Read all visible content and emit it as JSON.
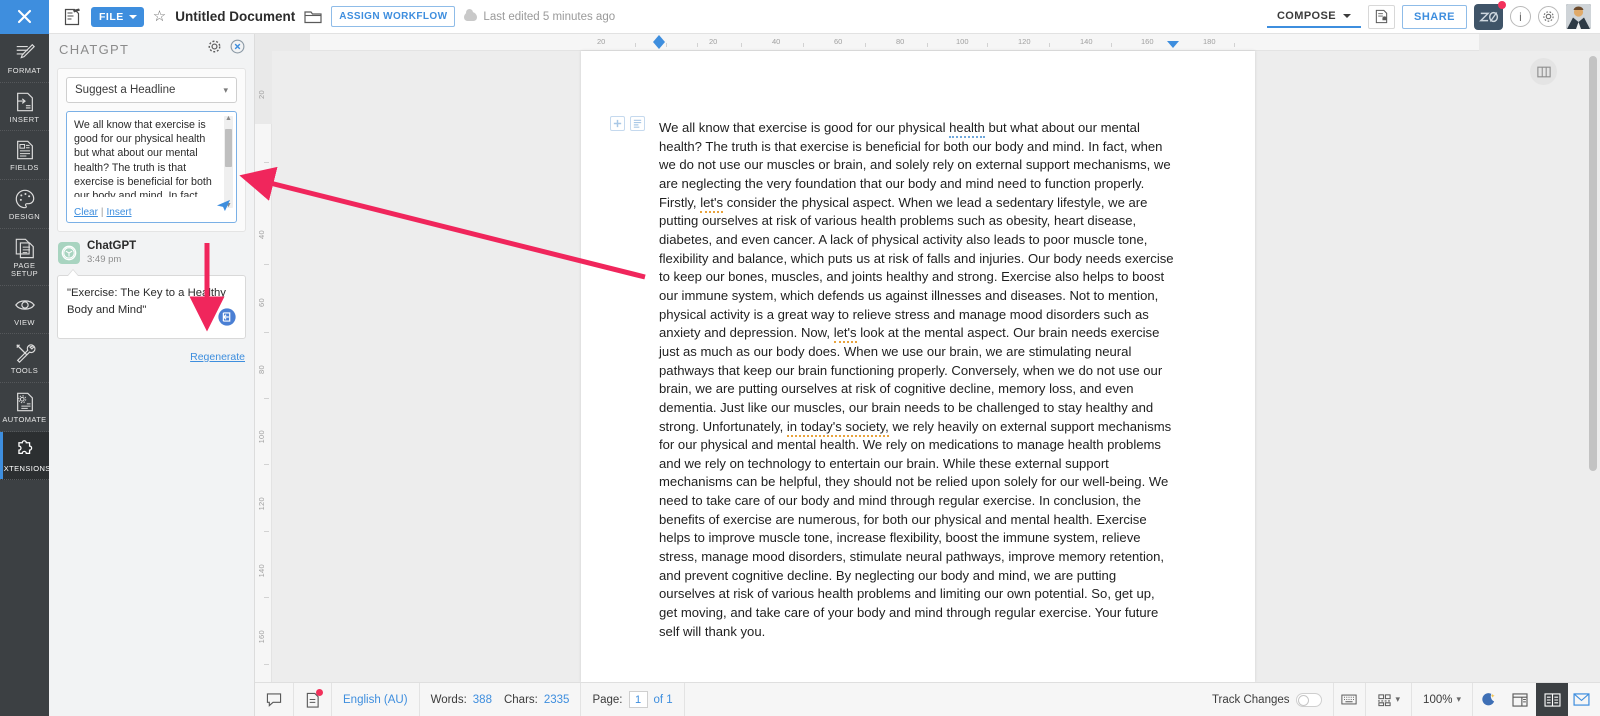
{
  "topbar": {
    "close_icon": "close-x-icon",
    "doc_icon": "document-edit-icon",
    "file_label": "FILE",
    "star_icon": "star-outline-icon",
    "title": "Untitled Document",
    "folder_icon": "folder-icon",
    "assign_workflow_label": "ASSIGN WORKFLOW",
    "last_edited": "Last edited 5 minutes ago",
    "compose_label": "COMPOSE",
    "notify_icon": "document-bell-icon",
    "share_label": "SHARE",
    "zia_label": "Zia",
    "info_icon": "info-circle-icon",
    "settings_icon": "gear-icon",
    "avatar_icon": "user-avatar"
  },
  "rail": {
    "items": [
      {
        "label": "FORMAT",
        "icon": "format-brush-icon",
        "active": false
      },
      {
        "label": "INSERT",
        "icon": "insert-page-icon",
        "active": false
      },
      {
        "label": "FIELDS",
        "icon": "fields-document-icon",
        "active": false
      },
      {
        "label": "DESIGN",
        "icon": "design-palette-icon",
        "active": false
      },
      {
        "label": "PAGE SETUP",
        "icon": "page-setup-icon",
        "active": false
      },
      {
        "label": "VIEW",
        "icon": "eye-icon",
        "active": false
      },
      {
        "label": "TOOLS",
        "icon": "tools-wrench-icon",
        "active": false
      },
      {
        "label": "AUTOMATE",
        "icon": "automate-gear-doc-icon",
        "active": false
      },
      {
        "label": "EXTENSIONS",
        "icon": "puzzle-piece-icon",
        "active": true
      }
    ]
  },
  "panel": {
    "title": "CHATGPT",
    "settings_icon": "gear-icon",
    "close_icon": "close-circle-icon",
    "prompt_type": "Suggest a Headline",
    "prompt_text": "We all know that exercise is good for our physical health but what about our mental health? The truth is that exercise is beneficial for both our body and mind. In fact, when we do not use our muscles or brain, and solely rely on external support mechanisms, we are neglecting the very foundation that our body and mind need to function properly.",
    "clear_label": "Clear",
    "separator": "|",
    "insert_label": "Insert",
    "send_icon": "send-paper-plane-icon",
    "chat_name": "ChatGPT",
    "chat_time": "3:49 pm",
    "chat_avatar_icon": "chatgpt-logo-icon",
    "reply_text": "\"Exercise: The Key to a Healthy Body and Mind\"",
    "insert_reply_icon": "insert-into-document-icon",
    "regenerate_label": "Regenerate"
  },
  "rulers": {
    "horizontal_ticks": [
      "20",
      "20",
      "40",
      "60",
      "80",
      "100",
      "120",
      "140",
      "160",
      "180"
    ],
    "vertical_ticks": [
      "20",
      "40",
      "60",
      "80",
      "100",
      "120",
      "140",
      "160"
    ]
  },
  "document": {
    "paragraph_add_icon": "add-paragraph-icon",
    "paragraph_style_icon": "paragraph-style-icon",
    "float_panel_icon": "panel-layout-icon",
    "body_segments": [
      {
        "t": "We all know that exercise is good for our physical "
      },
      {
        "t": "health",
        "u": "blue"
      },
      {
        "t": " but what about our mental health? The truth is that exercise is beneficial for both our body and mind. In fact, when we do not use our muscles or brain, and solely rely on external support mechanisms, we are neglecting the very foundation that our body and mind need to function properly. Firstly, "
      },
      {
        "t": "let's",
        "u": "gold"
      },
      {
        "t": " consider the physical aspect. When we lead a sedentary lifestyle, we are putting ourselves at risk of various health problems such as obesity, heart disease, diabetes, and even cancer. A lack of physical activity also leads to poor muscle tone, flexibility and balance, which puts us at risk of falls and injuries. Our body needs exercise to keep our bones, muscles, and joints healthy and strong. Exercise also helps to boost our immune system, which defends us against illnesses and diseases. Not to mention, physical activity is a great way to relieve stress and manage mood disorders such as anxiety and depression. Now, "
      },
      {
        "t": "let's",
        "u": "gold"
      },
      {
        "t": " look at the mental aspect. Our brain needs exercise just as much as our body does. When we use our brain, we are stimulating neural pathways that keep our brain functioning properly. Conversely, when we do not use our brain, we are putting ourselves at risk of cognitive decline, memory loss, and even dementia. Just like our muscles, our brain needs to be challenged to stay healthy and strong. Unfortunately, "
      },
      {
        "t": "in today's society,",
        "u": "gold"
      },
      {
        "t": " we rely heavily on external support mechanisms for our physical and mental health. We rely on medications to manage health problems and we rely on technology to entertain our brain. While these external support mechanisms can be helpful, they should not be relied upon solely for our well-being. We need to take care of our body and mind through regular exercise. In conclusion, the benefits of exercise are numerous, for both our physical and mental health. Exercise helps to improve muscle tone, increase flexibility, boost the immune system, relieve stress, manage mood disorders, stimulate neural pathways, improve memory retention, and prevent cognitive decline. By neglecting our body and mind, we are putting ourselves at risk of various health problems and limiting our own potential. So, get up, get moving, and take care of your body and mind through regular exercise. Your future self will thank you."
      }
    ]
  },
  "statusbar": {
    "comment_icon": "comment-bubble-icon",
    "review_icon": "review-document-icon",
    "language": "English (AU)",
    "words_label": "Words:",
    "words_value": "388",
    "chars_label": "Chars:",
    "chars_value": "2335",
    "page_label": "Page:",
    "page_current": "1",
    "page_of": "of 1",
    "track_changes_label": "Track Changes",
    "track_changes_on": false,
    "keyboard_icon": "keyboard-icon",
    "layout_icon": "page-break-icon",
    "zoom_value": "100%",
    "dark_mode_icon": "moon-icon",
    "view_web_icon": "web-layout-icon",
    "view_book_icon": "book-layout-icon",
    "view_mail_icon": "mail-layout-icon"
  },
  "annotations": {
    "arrow_color": "#f0265c",
    "arrow_long_name": "annotation-arrow-to-prompt",
    "arrow_down_name": "annotation-arrow-to-reply"
  }
}
